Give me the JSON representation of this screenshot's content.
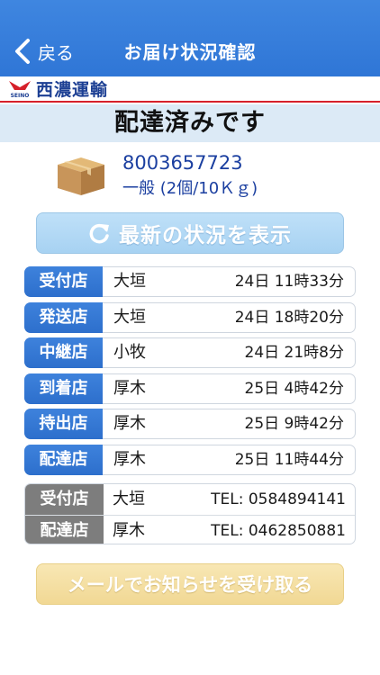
{
  "navbar": {
    "back_label": "戻る",
    "title": "お届け状況確認"
  },
  "brand": {
    "logo_text": "SEINO",
    "name": "西濃運輸"
  },
  "status": "配達済みです",
  "package": {
    "number": "8003657723",
    "detail": "一般 (2個/10Ｋｇ)",
    "icon": "cardboard-box-icon"
  },
  "refresh_button": {
    "label": "最新の状況を表示",
    "icon": "refresh-icon"
  },
  "tracking": [
    {
      "label": "受付店",
      "place": "大垣",
      "time": "24日 11時33分"
    },
    {
      "label": "発送店",
      "place": "大垣",
      "time": "24日 18時20分"
    },
    {
      "label": "中継店",
      "place": "小牧",
      "time": "24日 21時8分"
    },
    {
      "label": "到着店",
      "place": "厚木",
      "time": "25日 4時42分"
    },
    {
      "label": "持出店",
      "place": "厚木",
      "time": "25日 9時42分"
    },
    {
      "label": "配達店",
      "place": "厚木",
      "time": "25日 11時44分"
    }
  ],
  "contacts": [
    {
      "label": "受付店",
      "place": "大垣",
      "tel": "TEL: 0584894141"
    },
    {
      "label": "配達店",
      "place": "厚木",
      "tel": "TEL: 0462850881"
    }
  ],
  "mail_button": {
    "label": "メールでお知らせを受け取る"
  },
  "colors": {
    "nav_blue": "#2f76d6",
    "brand_red": "#d6202a",
    "label_blue": "#2d6fcc",
    "label_gray": "#7d7d7d",
    "refresh_blue": "#a7d2f2",
    "mail_yellow": "#f1d894"
  }
}
